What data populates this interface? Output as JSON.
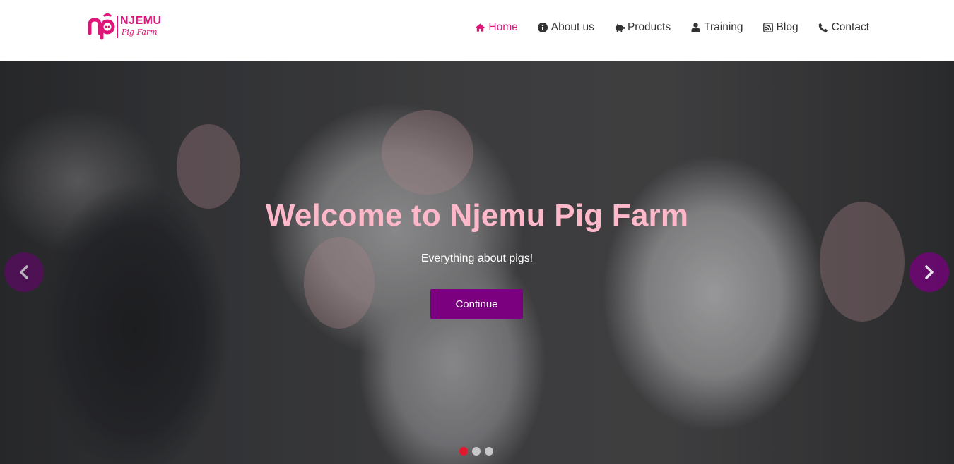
{
  "brand": {
    "name": "NJEMU",
    "subtitle": "Pig Farm",
    "monogram": "np",
    "color": "#e0157a"
  },
  "nav": {
    "items": [
      {
        "label": "Home",
        "icon": "home-icon",
        "active": true
      },
      {
        "label": "About us",
        "icon": "info-icon",
        "active": false
      },
      {
        "label": "Products",
        "icon": "piggy-bank-icon",
        "active": false
      },
      {
        "label": "Training",
        "icon": "user-icon",
        "active": false
      },
      {
        "label": "Blog",
        "icon": "rss-icon",
        "active": false
      },
      {
        "label": "Contact",
        "icon": "phone-icon",
        "active": false
      }
    ],
    "active_color": "#e0157a",
    "text_color": "#333333"
  },
  "hero": {
    "title": "Welcome to Njemu Pig Farm",
    "subtitle": "Everything about pigs!",
    "button_label": "Continue",
    "button_color": "#7a0080",
    "title_color": "#ffb8c9",
    "slides": 3,
    "active_slide": 1,
    "prev_icon": "chevron-left-icon",
    "next_icon": "chevron-right-icon"
  }
}
